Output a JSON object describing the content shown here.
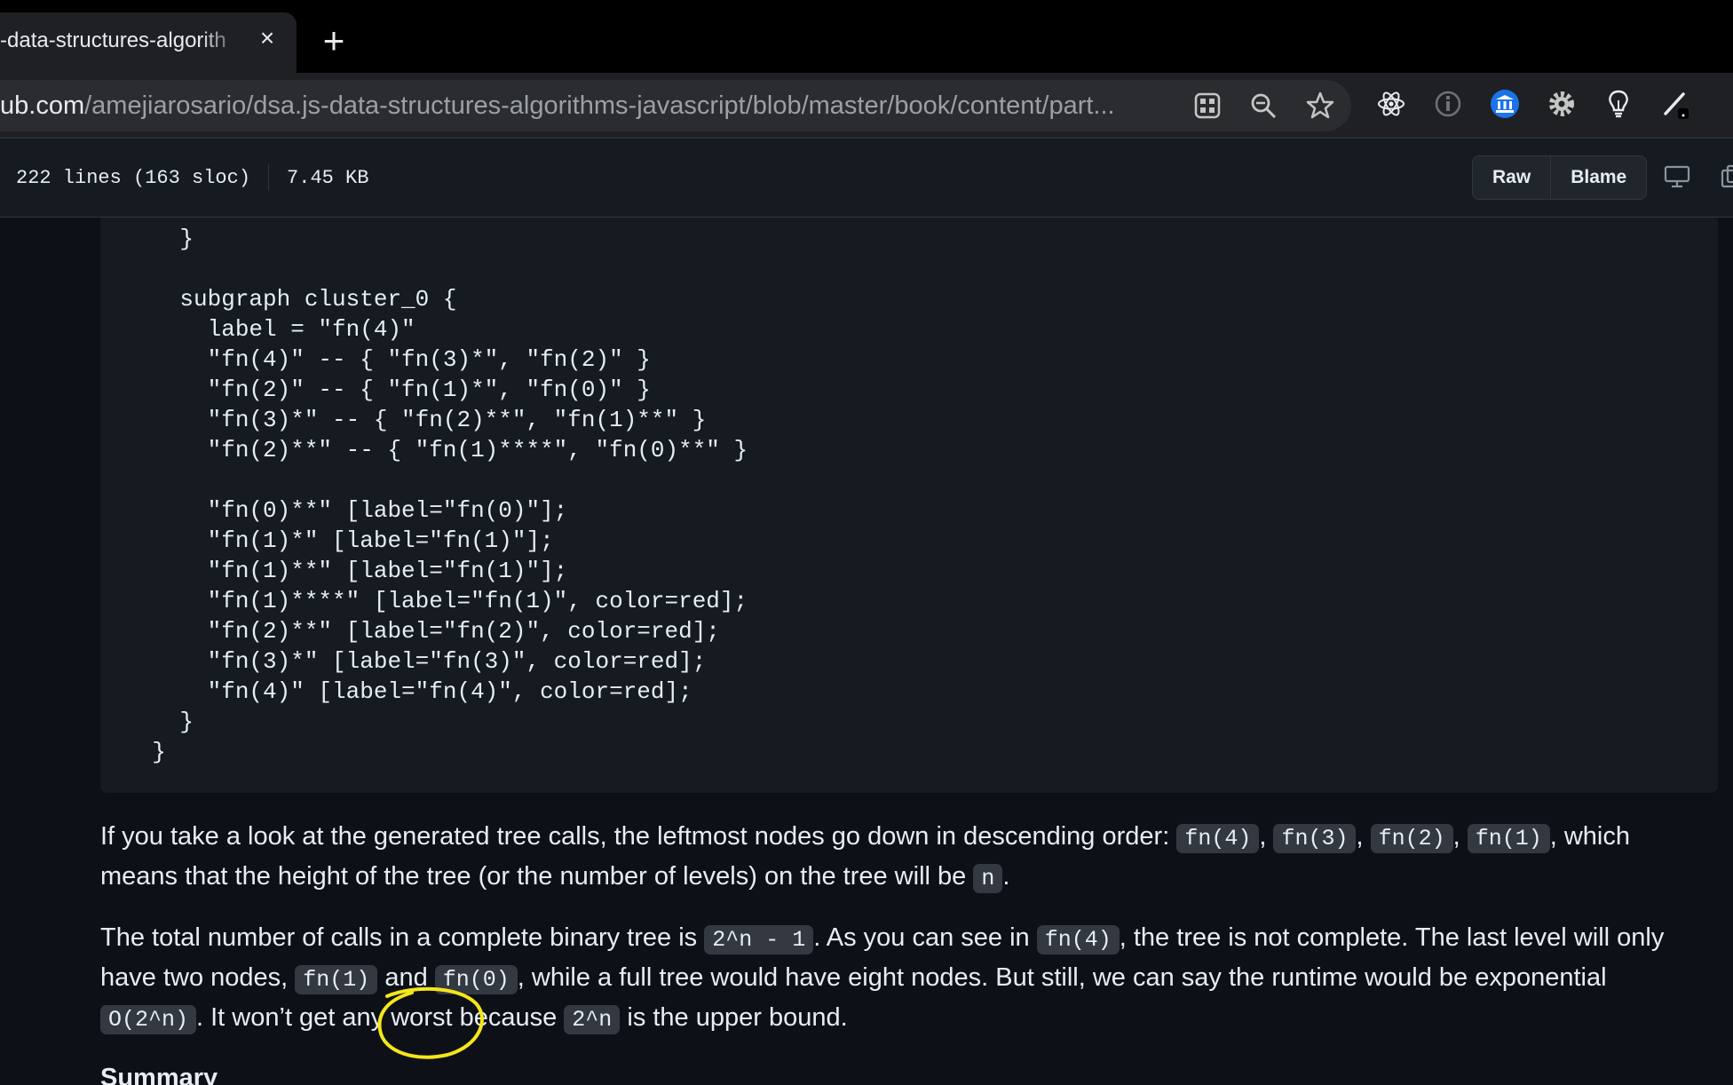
{
  "browser": {
    "tab_title": "-data-structures-algorith",
    "tab_close": "×",
    "new_tab": "+",
    "url_host": "ub.com",
    "url_path": "/amejiarosario/dsa.js-data-structures-algorithms-javascript/blob/master/book/content/part...",
    "omnibox_icons": [
      "app-grid-icon",
      "zoom-icon",
      "bookmark-star-icon"
    ],
    "extension_icons": [
      "react-devtools-icon",
      "info-icon",
      "bank-icon",
      "settings-gear-icon",
      "lightbulb-icon",
      "pen-icon"
    ]
  },
  "file_header": {
    "lines": "222 lines (163 sloc)",
    "size": "7.45 KB",
    "raw_label": "Raw",
    "blame_label": "Blame"
  },
  "code": {
    "lines": [
      "    }",
      "",
      "    subgraph cluster_0 {",
      "      label = \"fn(4)\"",
      "      \"fn(4)\" -- { \"fn(3)*\", \"fn(2)\" }",
      "      \"fn(2)\" -- { \"fn(1)*\", \"fn(0)\" }",
      "      \"fn(3)*\" -- { \"fn(2)**\", \"fn(1)**\" }",
      "      \"fn(2)**\" -- { \"fn(1)****\", \"fn(0)**\" }",
      "",
      "      \"fn(0)**\" [label=\"fn(0)\"];",
      "      \"fn(1)*\" [label=\"fn(1)\"];",
      "      \"fn(1)**\" [label=\"fn(1)\"];",
      "      \"fn(1)****\" [label=\"fn(1)\", color=red];",
      "      \"fn(2)**\" [label=\"fn(2)\", color=red];",
      "      \"fn(3)*\" [label=\"fn(3)\", color=red];",
      "      \"fn(4)\" [label=\"fn(4)\", color=red];",
      "    }",
      "  }"
    ]
  },
  "para1": {
    "t1": "If you take a look at the generated tree calls, the leftmost nodes go down in descending order: ",
    "c1": "fn(4)",
    "s1": ", ",
    "c2": "fn(3)",
    "s2": ", ",
    "c3": "fn(2)",
    "s3": ", ",
    "c4": "fn(1)",
    "t2": ", which means that the height of the tree (or the number of levels) on the tree will be ",
    "c5": "n",
    "t3": "."
  },
  "para2": {
    "t1": "The total number of calls in a complete binary tree is ",
    "c1": "2^n - 1",
    "t2": ". As you can see in ",
    "c2": "fn(4)",
    "t3": ", the tree is not complete. The last level will only have two nodes, ",
    "c3": "fn(1)",
    "t4": " and ",
    "c4": "fn(0)",
    "t5": ", while a full tree would have eight nodes. But still, we can say the runtime would be exponential ",
    "c5": "O(2^n)",
    "t6": ". It won’t get any worst because ",
    "c6": "2^n",
    "t7": " is the upper bound."
  },
  "summary_heading": "Summary",
  "colors": {
    "page_bg": "#0d1117",
    "code_bg": "#161b22",
    "inline_code_bg": "#343941",
    "annotation": "#f5e61a",
    "ext_blue": "#1a73e8"
  }
}
